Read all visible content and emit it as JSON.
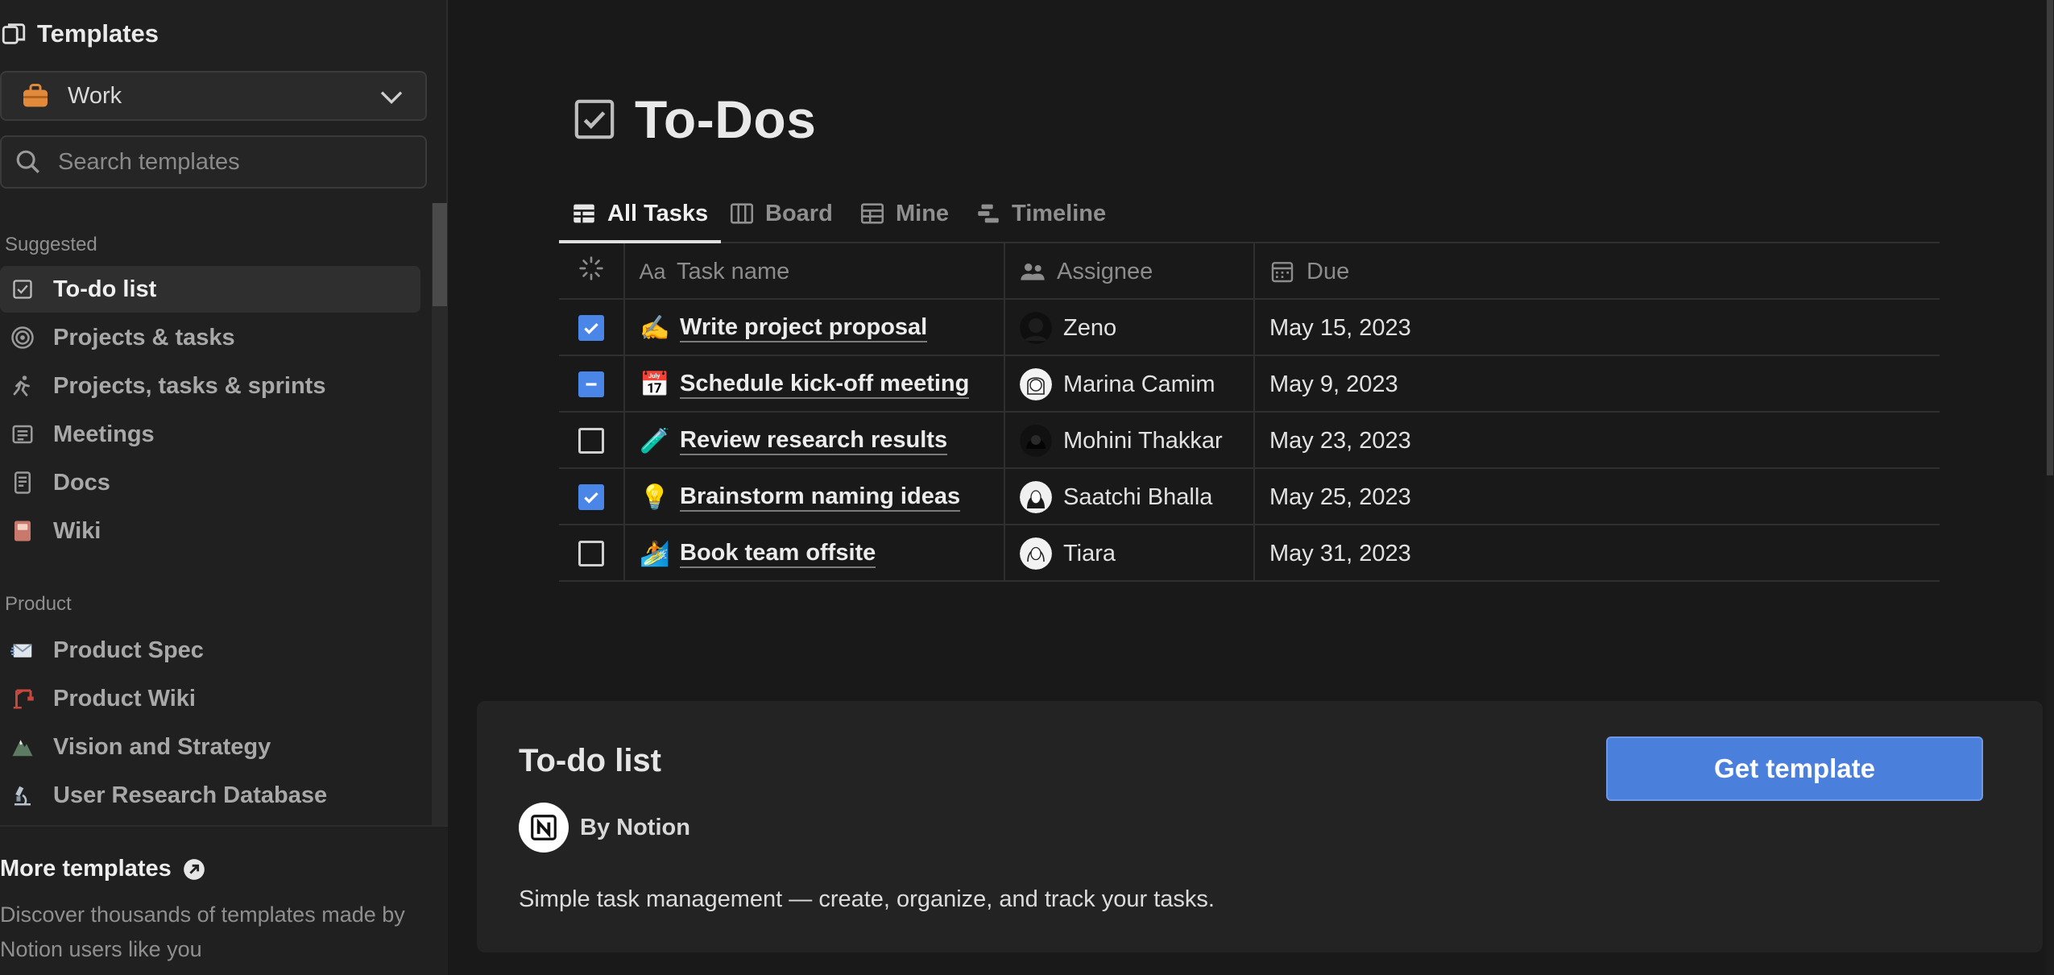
{
  "sidebar": {
    "title": "Templates",
    "category": {
      "selected": "Work"
    },
    "search": {
      "placeholder": "Search templates",
      "value": ""
    },
    "sections": [
      {
        "heading": "Suggested",
        "items": [
          {
            "label": "To-do list",
            "icon": "checkbox-icon",
            "active": true
          },
          {
            "label": "Projects & tasks",
            "icon": "target-icon"
          },
          {
            "label": "Projects, tasks & sprints",
            "icon": "running-person-icon"
          },
          {
            "label": "Meetings",
            "icon": "notes-icon"
          },
          {
            "label": "Docs",
            "icon": "document-icon"
          },
          {
            "label": "Wiki",
            "icon": "book-icon"
          }
        ]
      },
      {
        "heading": "Product",
        "items": [
          {
            "label": "Product Spec",
            "icon": "envelope-icon"
          },
          {
            "label": "Product Wiki",
            "icon": "crane-icon"
          },
          {
            "label": "Vision and Strategy",
            "icon": "mountain-icon"
          },
          {
            "label": "User Research Database",
            "icon": "microscope-icon"
          }
        ]
      }
    ],
    "more": {
      "title": "More templates",
      "description": "Discover thousands of templates made by Notion users like you"
    }
  },
  "main": {
    "title": "To-Dos",
    "tabs": [
      {
        "label": "All Tasks",
        "icon": "table-icon",
        "active": true
      },
      {
        "label": "Board",
        "icon": "board-icon"
      },
      {
        "label": "Mine",
        "icon": "table-outline-icon"
      },
      {
        "label": "Timeline",
        "icon": "timeline-icon"
      }
    ],
    "table": {
      "headers": {
        "status": "",
        "name": "Task name",
        "name_prefix": "Aa",
        "assignee": "Assignee",
        "due": "Due"
      },
      "rows": [
        {
          "status": "checked",
          "emoji": "✍️",
          "name": "Write project proposal",
          "assignee": "Zeno",
          "due": "May 15, 2023"
        },
        {
          "status": "mixed",
          "emoji": "📅",
          "name": "Schedule kick-off meeting",
          "assignee": "Marina Camim",
          "due": "May 9, 2023"
        },
        {
          "status": "empty",
          "emoji": "🧪",
          "name": "Review research results",
          "assignee": "Mohini Thakkar",
          "due": "May 23, 2023"
        },
        {
          "status": "checked",
          "emoji": "💡",
          "name": "Brainstorm naming ideas",
          "assignee": "Saatchi Bhalla",
          "due": "May 25, 2023"
        },
        {
          "status": "empty",
          "emoji": "🏄",
          "name": "Book team offsite",
          "assignee": "Tiara",
          "due": "May 31, 2023"
        }
      ]
    }
  },
  "card": {
    "title": "To-do list",
    "author": "By Notion",
    "description": "Simple task management — create, organize, and track your tasks.",
    "button": "Get template"
  },
  "colors": {
    "accent": "#4b7fdc",
    "background": "#191919",
    "sidebar": "#202020",
    "bag": "#e08a3a"
  }
}
